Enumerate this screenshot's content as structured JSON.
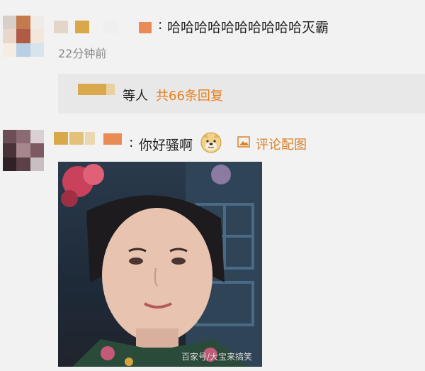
{
  "comment1": {
    "sep": ":",
    "text": "哈哈哈哈哈哈哈哈哈哈灭霸",
    "time": "22分钟前"
  },
  "reply_summary": {
    "suffix": "等人",
    "count_text": "共66条回复"
  },
  "comment2": {
    "sep": ":",
    "text": "你好骚啊",
    "emoji_icon": "doge-icon",
    "pic_icon": "image-icon",
    "pic_label": "评论配图"
  },
  "watermark": "百家号/大宝来搞笑",
  "colors": {
    "link": "#d9822b",
    "count": "#e87e1e",
    "reply_bg": "#e8e8e8",
    "page_bg": "#f2f2f2"
  }
}
